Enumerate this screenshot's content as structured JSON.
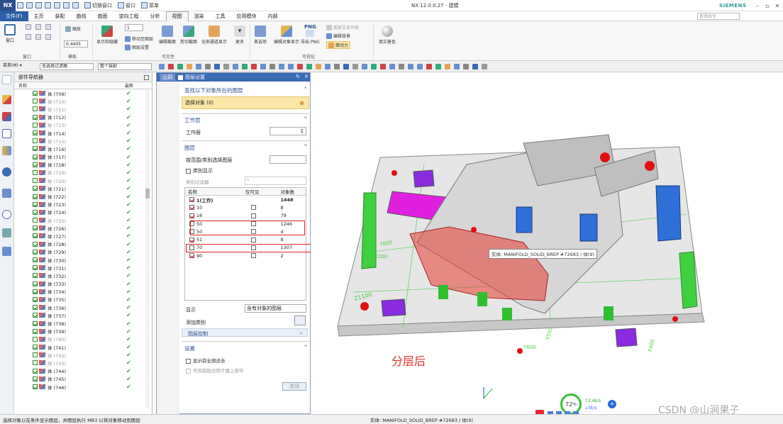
{
  "window": {
    "app_logo": "NX",
    "title": "NX 12.0.0.27 - 建模",
    "brand": "SIEMENS",
    "quick_toolbar": {
      "command_finder": "切换窗口",
      "window": "窗口",
      "menu": "菜单"
    }
  },
  "menubar": {
    "items": [
      "文件(F)",
      "主页",
      "装配",
      "曲线",
      "曲面",
      "逆向工程",
      "分析",
      "视图",
      "渲染",
      "工具",
      "应用模块",
      "内部"
    ],
    "active_index": 7,
    "search_placeholder": "查找命令"
  },
  "ribbon": {
    "groups": [
      "窗口",
      "模板",
      "可见性",
      "可视化"
    ],
    "window_btn": "窗口",
    "scale_label": "缩放",
    "zoom_value": "0.4405",
    "layer_value": "1",
    "buttons": {
      "show_hide": "显示和隐藏",
      "move_layer": "移动至图层",
      "layer_settings": "图层设置",
      "edit_section": "编辑截面",
      "clip_section": "剪切截面",
      "show_all_sections": "全部通道显示",
      "more": "更多",
      "preferences": "首选项",
      "edit_object_display": "编辑对象显示",
      "export_png": "导出 PNG",
      "restore_bg": "编辑背景",
      "animate": "面动力",
      "reflection_color": "反射文本外观",
      "true_shading": "真实着色"
    },
    "png_label": "PNG"
  },
  "selection_bar": {
    "menu_label": "菜单(M) ▾",
    "filter": "无选择过滤器",
    "scope": "整个装配"
  },
  "navigator": {
    "title": "部件导航器",
    "col_name": "名称",
    "col_latest": "最新",
    "rows": [
      {
        "label": "体 (709)",
        "checked": true,
        "gray": false
      },
      {
        "label": "体 (710)",
        "checked": false,
        "gray": true
      },
      {
        "label": "体 (711)",
        "checked": false,
        "gray": true
      },
      {
        "label": "体 (712)",
        "checked": true,
        "gray": false
      },
      {
        "label": "体 (713)",
        "checked": false,
        "gray": true
      },
      {
        "label": "体 (714)",
        "checked": true,
        "gray": false
      },
      {
        "label": "体 (715)",
        "checked": false,
        "gray": true
      },
      {
        "label": "体 (716)",
        "checked": true,
        "gray": false
      },
      {
        "label": "体 (717)",
        "checked": true,
        "gray": false
      },
      {
        "label": "体 (718)",
        "checked": true,
        "gray": false
      },
      {
        "label": "体 (719)",
        "checked": false,
        "gray": true
      },
      {
        "label": "体 (720)",
        "checked": false,
        "gray": true
      },
      {
        "label": "体 (721)",
        "checked": true,
        "gray": false
      },
      {
        "label": "体 (722)",
        "checked": true,
        "gray": false
      },
      {
        "label": "体 (723)",
        "checked": true,
        "gray": false
      },
      {
        "label": "体 (724)",
        "checked": true,
        "gray": false
      },
      {
        "label": "体 (725)",
        "checked": false,
        "gray": true
      },
      {
        "label": "体 (726)",
        "checked": true,
        "gray": false
      },
      {
        "label": "体 (727)",
        "checked": true,
        "gray": false
      },
      {
        "label": "体 (728)",
        "checked": true,
        "gray": false
      },
      {
        "label": "体 (729)",
        "checked": true,
        "gray": false
      },
      {
        "label": "体 (730)",
        "checked": true,
        "gray": false
      },
      {
        "label": "体 (731)",
        "checked": true,
        "gray": false
      },
      {
        "label": "体 (732)",
        "checked": true,
        "gray": false
      },
      {
        "label": "体 (733)",
        "checked": true,
        "gray": false
      },
      {
        "label": "体 (734)",
        "checked": true,
        "gray": false
      },
      {
        "label": "体 (735)",
        "checked": true,
        "gray": false
      },
      {
        "label": "体 (736)",
        "checked": true,
        "gray": false
      },
      {
        "label": "体 (737)",
        "checked": true,
        "gray": false
      },
      {
        "label": "体 (738)",
        "checked": true,
        "gray": false
      },
      {
        "label": "体 (739)",
        "checked": true,
        "gray": false
      },
      {
        "label": "体 (740)",
        "checked": false,
        "gray": true
      },
      {
        "label": "体 (741)",
        "checked": true,
        "gray": false
      },
      {
        "label": "体 (742)",
        "checked": false,
        "gray": true
      },
      {
        "label": "体 (743)",
        "checked": false,
        "gray": true
      },
      {
        "label": "体 (744)",
        "checked": true,
        "gray": false
      },
      {
        "label": "体 (745)",
        "checked": true,
        "gray": false
      },
      {
        "label": "体 (746)",
        "checked": true,
        "gray": false
      }
    ]
  },
  "layer_dialog": {
    "tab_small": "山洞",
    "title": "图层设置",
    "find_section": "查找以下对象所在的图层",
    "select_object": "选择对象 (0)",
    "work_layer_section": "工作层",
    "work_layer_label": "工作层",
    "work_layer_value": "1",
    "layer_section": "图层",
    "by_range_label": "按范围/类别选择图层",
    "category_display": "类别显示",
    "category_filter": "类别过滤器",
    "category_filter_value": "*",
    "col_name": "名称",
    "col_visible": "仅可见",
    "col_count": "对象数",
    "rows": [
      {
        "name": "1(工作)",
        "checked": true,
        "visible_only": null,
        "count": "1448",
        "bold": true
      },
      {
        "name": "10",
        "checked": true,
        "visible_only": false,
        "count": "8",
        "bold": false
      },
      {
        "name": "16",
        "checked": true,
        "visible_only": false,
        "count": "79",
        "bold": false
      },
      {
        "name": "50",
        "checked": false,
        "visible_only": false,
        "count": "1246",
        "bold": false
      },
      {
        "name": "50",
        "checked": false,
        "visible_only": false,
        "count": "4",
        "bold": false
      },
      {
        "name": "51",
        "checked": true,
        "visible_only": false,
        "count": "8",
        "bold": false
      },
      {
        "name": "70",
        "checked": false,
        "visible_only": false,
        "count": "1307",
        "bold": false
      },
      {
        "name": "90",
        "checked": true,
        "visible_only": false,
        "count": "2",
        "bold": false
      }
    ],
    "display_label": "显示",
    "display_value": "含有对象的图层",
    "add_category": "添加类别",
    "layer_control": "图层控制",
    "settings_section": "设置",
    "fit_all": "显示前全部适合",
    "use_assembly": "考虑装配适用于属上部件",
    "close_button": "关闭"
  },
  "viewport": {
    "annotation": "分层后",
    "tooltip": "实体: MANIFOLD_SOLID_BREP #72683 / 体(9)",
    "coord_labels": [
      "Z1100",
      "X200",
      "Y600",
      "Y600",
      "X400",
      "X550"
    ],
    "gauge_percent": "72",
    "gauge_unit": "%",
    "speed_up": "2.4k/s",
    "speed_down": "0k/s",
    "watermark": "CSDN @山涧果子"
  },
  "statusbar": {
    "left": "选择对象以在条件显示图层，并图层执行 MB3 以将对象移动到图层",
    "center": "实体: MANIFOLD_SOLID_BREP #72683 / 体(9)"
  },
  "colors": {
    "accent": "#2a5ea6",
    "highlight": "#fbe6a8",
    "red_annotation": "#e23030",
    "check_green": "#2aa82a"
  }
}
